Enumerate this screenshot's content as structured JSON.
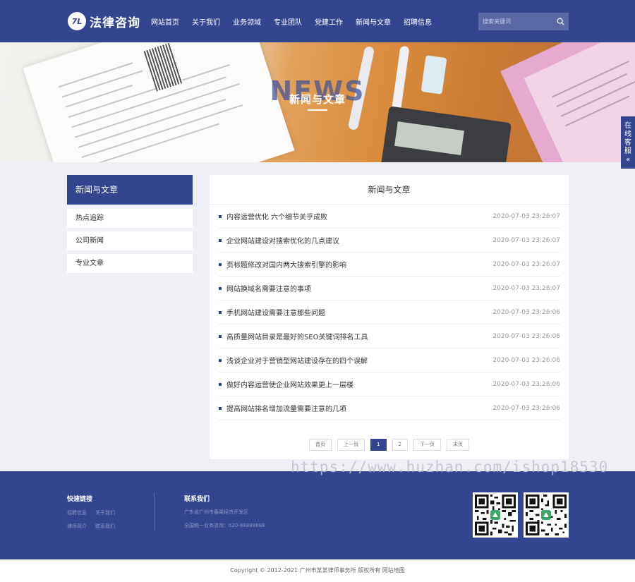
{
  "header": {
    "logo_mark": "7L",
    "logo_text": "法律咨询",
    "nav": [
      "网站首页",
      "关于我们",
      "业务领域",
      "专业团队",
      "党建工作",
      "新闻与文章",
      "招聘信息"
    ],
    "search_placeholder": "搜索关键词"
  },
  "banner": {
    "bg_word": "NEWS",
    "title": "新闻与文章"
  },
  "service_tab": [
    "在",
    "线",
    "客",
    "服",
    "«"
  ],
  "sidebar": {
    "heading": "新闻与文章",
    "items": [
      "热点追踪",
      "公司新闻",
      "专业文章"
    ]
  },
  "main": {
    "title": "新闻与文章",
    "articles": [
      {
        "title": "内容运营优化 六个细节关乎成败",
        "date": "2020-07-03 23:26:07"
      },
      {
        "title": "企业网站建设对搜索优化的几点建议",
        "date": "2020-07-03 23:26:07"
      },
      {
        "title": "页标题修改对国内两大搜索引擎的影响",
        "date": "2020-07-03 23:26:07"
      },
      {
        "title": "网站换域名需要注意的事项",
        "date": "2020-07-03 23:26:07"
      },
      {
        "title": "手机网站建设需要注意那些问题",
        "date": "2020-07-03 23:26:06"
      },
      {
        "title": "高质量网站目录是最好的SEO关键词排名工具",
        "date": "2020-07-03 23:26:06"
      },
      {
        "title": "浅谈企业对于营销型网站建设存在的四个误解",
        "date": "2020-07-03 23:26:06"
      },
      {
        "title": "做好内容运营使企业网站效果更上一层楼",
        "date": "2020-07-03 23:26:06"
      },
      {
        "title": "提高网站排名增加流量需要注意的几项",
        "date": "2020-07-03 23:26:06"
      }
    ],
    "pager": {
      "first": "首页",
      "prev": "上一页",
      "pages": [
        "1",
        "2"
      ],
      "current": "1",
      "next": "下一页",
      "last": "末页"
    }
  },
  "watermark": "https://www.huzhan.com/ishop18530",
  "footer": {
    "links_heading": "快速链接",
    "links": [
      "招聘信息",
      "关于我们",
      "律师简介",
      "联系我们"
    ],
    "contact_heading": "联系我们",
    "address": "广东省广州市番禺经济开发区",
    "phone": "全国统一业务咨询：020-88888888",
    "copyright": "Copyright © 2012-2021 广州市某某律师事务所 版权所有 网站地图"
  },
  "colors": {
    "brand": "#33458f",
    "background": "#eef0f6"
  }
}
